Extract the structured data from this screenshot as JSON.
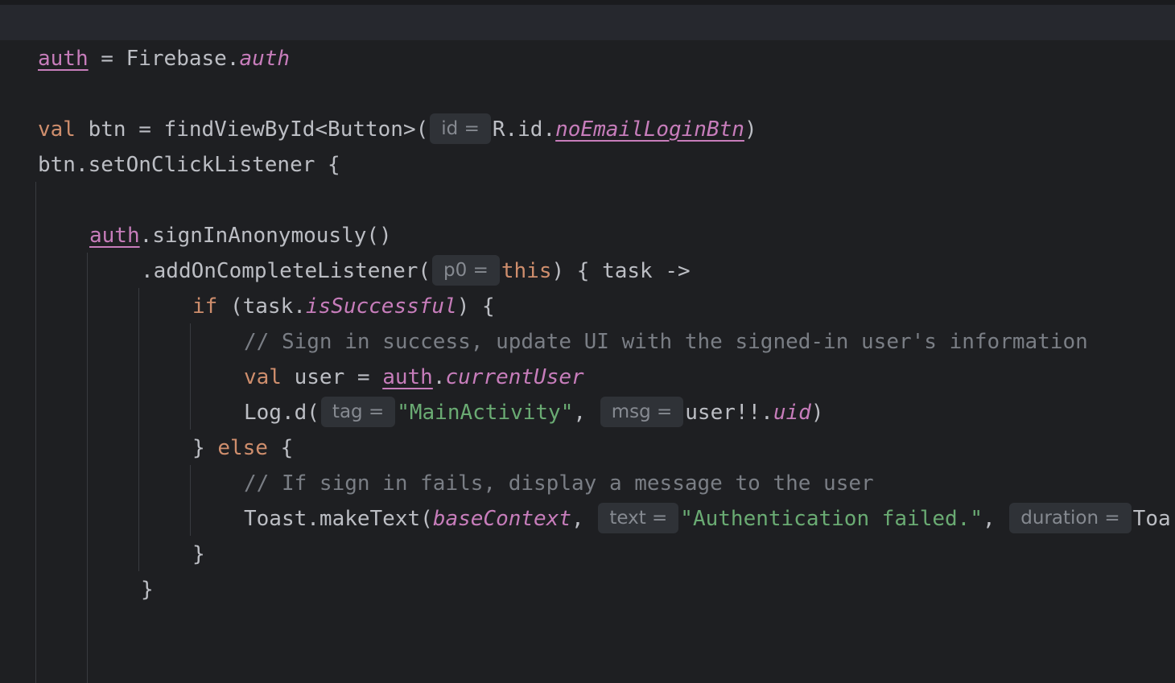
{
  "editor": {
    "lines": {
      "l1": {
        "auth": "auth",
        "eq": " = Firebase.",
        "auth_prop": "auth"
      },
      "l2": {
        "val": "val",
        "decl": " btn = findViewById<Button>(",
        "hint": "id =",
        "rid": "R.id.",
        "btn_id": "noEmailLoginBtn",
        "close": ")"
      },
      "l3": {
        "text": "btn.setOnClickListener {"
      },
      "l4": {
        "auth": "auth",
        "call": ".signInAnonymously()"
      },
      "l5": {
        "call": ".addOnCompleteListener(",
        "hint": "p0 =",
        "this": "this",
        "rest": ") { task ->"
      },
      "l6": {
        "if": "if",
        "open": " (task.",
        "prop": "isSuccessful",
        "close": ") {"
      },
      "l7": {
        "comment": "// Sign in success, update UI with the signed-in user's information"
      },
      "l8": {
        "val": "val",
        "decl": " user = ",
        "auth": "auth",
        "dot": ".",
        "prop": "currentUser"
      },
      "l9": {
        "call": "Log.d(",
        "hint_tag": "tag =",
        "str": "\"MainActivity\"",
        "comma": ", ",
        "hint_msg": "msg =",
        "user": "user!!.",
        "uid": "uid",
        "close": ")"
      },
      "l10": {
        "brace": "} ",
        "else": "else",
        "open": " {"
      },
      "l11": {
        "comment": "// If sign in fails, display a message to the user"
      },
      "l12": {
        "call": "Toast.makeText(",
        "ctx": "baseContext",
        "comma1": ", ",
        "hint_text": "text =",
        "str": "\"Authentication failed.\"",
        "comma2": ", ",
        "hint_duration": "duration =",
        "tail": "Toa"
      },
      "l13": {
        "brace": "}"
      },
      "l14": {
        "brace": "}"
      }
    }
  },
  "colors": {
    "background": "#1e1f22",
    "current_line": "#26282e",
    "keyword": "#cf8e6d",
    "property": "#c77dbb",
    "string": "#6aab73",
    "comment": "#7a7e85",
    "text": "#bcbec4",
    "hint_bg": "#2f3237",
    "hint_text": "#868a91"
  }
}
